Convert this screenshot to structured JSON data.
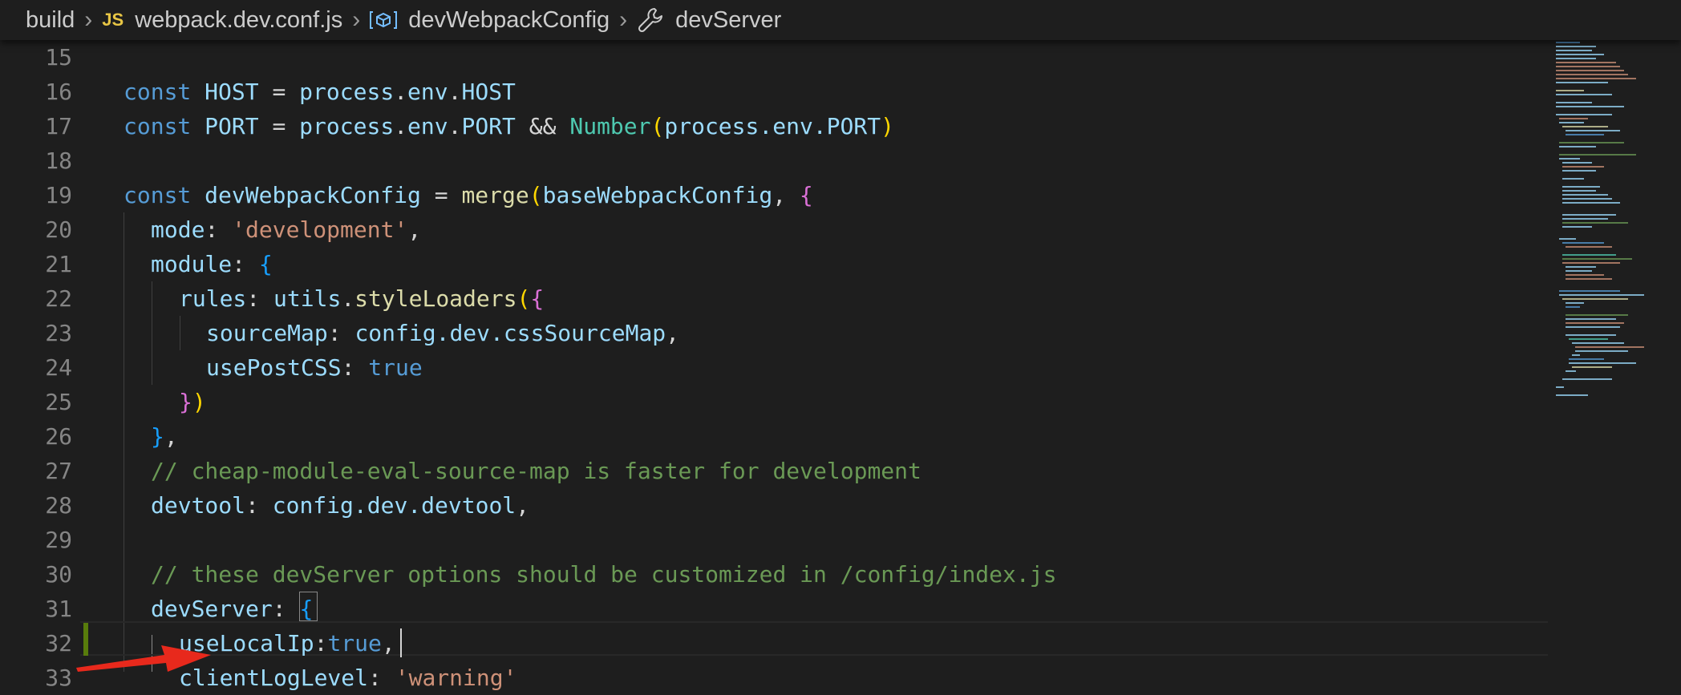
{
  "breadcrumb": {
    "folder": "build",
    "file_icon_text": "JS",
    "file": "webpack.dev.conf.js",
    "variable": "devWebpackConfig",
    "property": "devServer",
    "icons": [
      "chevron-right-icon",
      "js-file-icon",
      "variable-icon",
      "wrench-icon"
    ]
  },
  "editor": {
    "line_numbers": [
      "15",
      "16",
      "17",
      "18",
      "19",
      "20",
      "21",
      "22",
      "23",
      "24",
      "25",
      "26",
      "27",
      "28",
      "29",
      "30",
      "31",
      "32",
      "33"
    ],
    "lines": {
      "l16": {
        "const": "const",
        "name": "HOST",
        "eq": " = ",
        "obj": "process",
        "d1": ".",
        "env": "env",
        "d2": ".",
        "prop": "HOST"
      },
      "l17": {
        "const": "const",
        "name": "PORT",
        "eq": " = ",
        "obj": "process",
        "d1": ".",
        "env": "env",
        "d2": ".",
        "prop": "PORT",
        "and": " && ",
        "fn": "Number",
        "open": "(",
        "arg": "process.env.PORT",
        "close": ")"
      },
      "l19": {
        "const": "const",
        "name": "devWebpackConfig",
        "eq": " = ",
        "fn": "merge",
        "open": "(",
        "arg": "baseWebpackConfig",
        "comma": ", ",
        "brace": "{"
      },
      "l20": {
        "key": "mode",
        "colon": ": ",
        "val": "'development'",
        "comma": ","
      },
      "l21": {
        "key": "module",
        "colon": ": ",
        "brace": "{"
      },
      "l22": {
        "key": "rules",
        "colon": ": ",
        "obj": "utils",
        "dot": ".",
        "fn": "styleLoaders",
        "open": "(",
        "brace": "{"
      },
      "l23": {
        "key": "sourceMap",
        "colon": ": ",
        "val": "config.dev.cssSourceMap",
        "comma": ","
      },
      "l24": {
        "key": "usePostCSS",
        "colon": ": ",
        "val": "true"
      },
      "l25": {
        "brace": "}",
        "close": ")"
      },
      "l26": {
        "brace": "}",
        "comma": ","
      },
      "l27": {
        "comment": "// cheap-module-eval-source-map is faster for development"
      },
      "l28": {
        "key": "devtool",
        "colon": ": ",
        "val": "config.dev.devtool",
        "comma": ","
      },
      "l30": {
        "comment": "// these devServer options should be customized in /config/index.js"
      },
      "l31": {
        "key": "devServer",
        "colon": ": ",
        "brace": "{"
      },
      "l32": {
        "key": "useLocalIp",
        "colon": ":",
        "val": "true",
        "comma": ","
      },
      "l33": {
        "key": "clientLogLevel",
        "colon": ": ",
        "val": "'warning'"
      }
    }
  },
  "colors": {
    "background": "#1e1e1e",
    "keyword": "#569cd6",
    "variable": "#9cdcfe",
    "string": "#ce9178",
    "comment": "#6a9955",
    "function": "#dcdcaa",
    "class": "#4ec9b0",
    "annotation_arrow": "#e8291c",
    "modified_gutter": "#587c0c"
  }
}
